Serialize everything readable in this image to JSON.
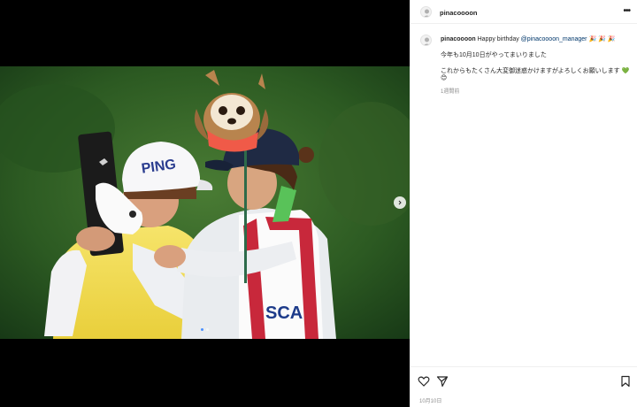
{
  "post": {
    "username": "pinacoooon",
    "more_label": "•••"
  },
  "caption": {
    "username": "pinacoooon",
    "text_before": "Happy birthday",
    "mention": "@pinacoooon_manager",
    "emojis_1": "🎉 🎉 🎉",
    "line2": "今年も10月10日がやってまいりました",
    "line3": "これからもたくさん大変御迷惑かけますがよろしくお願いします",
    "emoji_end_1": "💚",
    "emoji_end_2": "😊",
    "time_ago": "1週間前"
  },
  "footer": {
    "date": "10月10日"
  },
  "carousel": {
    "current_slide": 1,
    "total_slides": 2
  },
  "photo": {
    "cap_text": "PING",
    "shirt_text": "SCA"
  },
  "colors": {
    "accent": "#4a90ff",
    "mention": "#00376b",
    "grass_dark": "#1f4a1e",
    "grass_light": "#3c6e2c"
  },
  "icons": [
    "avatar",
    "more-icon",
    "heart-icon",
    "share-icon",
    "bookmark-icon",
    "chevron-right-icon"
  ]
}
